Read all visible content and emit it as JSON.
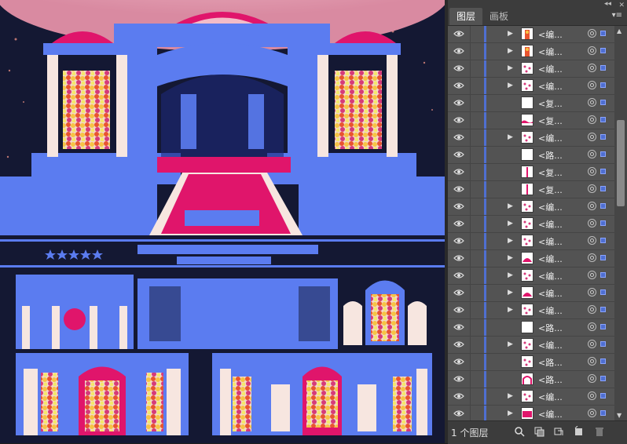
{
  "panel": {
    "tabs": [
      {
        "label": "图层",
        "active": true
      },
      {
        "label": "画板",
        "active": false
      }
    ],
    "collapse_label": "◂◂",
    "close_label": "✕",
    "menu_icon": "panel-menu-icon",
    "layers": [
      {
        "name": "<编...",
        "thumb": "figure",
        "expand": true
      },
      {
        "name": "<编...",
        "thumb": "figure",
        "expand": true
      },
      {
        "name": "<编...",
        "thumb": "pattern",
        "expand": true
      },
      {
        "name": "<编...",
        "thumb": "pattern",
        "expand": true
      },
      {
        "name": "<复...",
        "thumb": "blank",
        "expand": false
      },
      {
        "name": "<复...",
        "thumb": "wave",
        "expand": false
      },
      {
        "name": "<编...",
        "thumb": "pattern",
        "expand": true
      },
      {
        "name": "<路...",
        "thumb": "blank",
        "expand": false
      },
      {
        "name": "<复...",
        "thumb": "bar",
        "expand": false
      },
      {
        "name": "<复...",
        "thumb": "bar",
        "expand": false
      },
      {
        "name": "<编...",
        "thumb": "pattern",
        "expand": true
      },
      {
        "name": "<编...",
        "thumb": "pattern",
        "expand": true
      },
      {
        "name": "<编...",
        "thumb": "pattern",
        "expand": true
      },
      {
        "name": "<编...",
        "thumb": "dome",
        "expand": true
      },
      {
        "name": "<编...",
        "thumb": "pattern",
        "expand": true
      },
      {
        "name": "<编...",
        "thumb": "dome",
        "expand": true
      },
      {
        "name": "<编...",
        "thumb": "pattern",
        "expand": true
      },
      {
        "name": "<路...",
        "thumb": "blank",
        "expand": false
      },
      {
        "name": "<编...",
        "thumb": "pattern",
        "expand": true
      },
      {
        "name": "<路...",
        "thumb": "pattern",
        "expand": false
      },
      {
        "name": "<路...",
        "thumb": "arch",
        "expand": false
      },
      {
        "name": "<编...",
        "thumb": "pattern",
        "expand": true
      },
      {
        "name": "<编...",
        "thumb": "block",
        "expand": true
      },
      {
        "name": "<编...",
        "thumb": "pattern",
        "expand": true
      },
      {
        "name": "<编...",
        "thumb": "pattern",
        "expand": true
      }
    ]
  },
  "footer": {
    "layer_count": "1 个图层",
    "buttons": [
      "locate-object-icon",
      "make-clipping-mask-icon",
      "create-sublayer-icon",
      "new-layer-icon",
      "delete-icon"
    ]
  },
  "canvas": {
    "description_icon": "wedding-stage-artwork",
    "colors": {
      "bg": "#141833",
      "selection": "#5b7cf0",
      "accent": "#e0156b",
      "cream": "#f7e6e0"
    }
  }
}
